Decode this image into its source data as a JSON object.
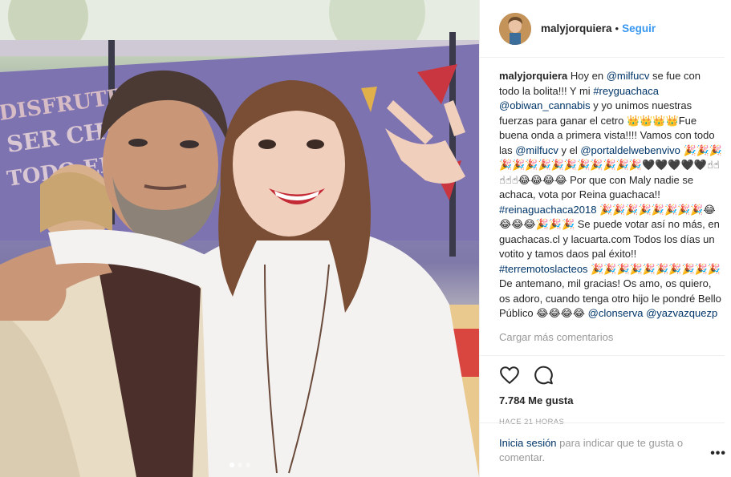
{
  "post": {
    "username": "malyjorquiera",
    "separator": "•",
    "follow_label": "Seguir",
    "caption": {
      "author": "malyjorquiera",
      "parts": [
        {
          "text": " Hoy en ",
          "link": false
        },
        {
          "text": "@milfucv",
          "link": true
        },
        {
          "text": " se fue con todo la bolita!!! Y mi ",
          "link": false
        },
        {
          "text": "#reyguachaca",
          "link": true
        },
        {
          "text": " ",
          "link": false
        },
        {
          "text": "@obiwan_cannabis",
          "link": true
        },
        {
          "text": " y yo unimos nuestras fuerzas para ganar el cetro 👑👑👑👑Fue buena onda a primera vista!!!! Vamos con todo las ",
          "link": false
        },
        {
          "text": "@milfucv",
          "link": true
        },
        {
          "text": " y el ",
          "link": false
        },
        {
          "text": "@portaldelwebenvivo",
          "link": true
        },
        {
          "text": " 🎉🎉🎉🎉🎉🎉🎉🎉🎉🎉🎉🎉🎉🎉🖤🖤🖤🖤🖤☝☝☝☝☝😂😂😂😂 Por que con Maly nadie se achaca, vota por Reina guachaca!! ",
          "link": false
        },
        {
          "text": "#reinaguachaca2018",
          "link": true
        },
        {
          "text": " 🎉🎉🎉🎉🎉🎉🎉🎉😂😂😂😂🎉🎉🎉 Se puede votar así no más, en guachacas.cl y lacuarta.com Todos los días un votito y tamos daos pal éxito!! ",
          "link": false
        },
        {
          "text": "#terremotoslacteos",
          "link": true
        },
        {
          "text": " 🎉🎉🎉🎉🎉🎉🎉🎉🎉🎉 De antemano, mil gracias! Os amo, os quiero, os adoro, cuando tenga otro hijo le pondré Bello Público 😂😂😂😂 ",
          "link": false
        },
        {
          "text": "@clonserva",
          "link": true
        },
        {
          "text": " ",
          "link": false
        },
        {
          "text": "@yazvazquezp",
          "link": true
        }
      ]
    },
    "load_more": "Cargar más comentarios",
    "likes": "7.784 Me gusta",
    "time": "HACE 21 HORAS",
    "login_link": "Inicia sesión",
    "login_text": " para indicar que te gusta o comentar.",
    "more_options": "•••",
    "carousel": {
      "count": 3,
      "active": 0
    }
  },
  "colors": {
    "link": "#003569",
    "follow": "#3897f0",
    "muted": "#999999",
    "text": "#262626",
    "divider": "#efefef"
  },
  "icons": [
    "heart-icon",
    "comment-icon",
    "more-options-icon"
  ]
}
